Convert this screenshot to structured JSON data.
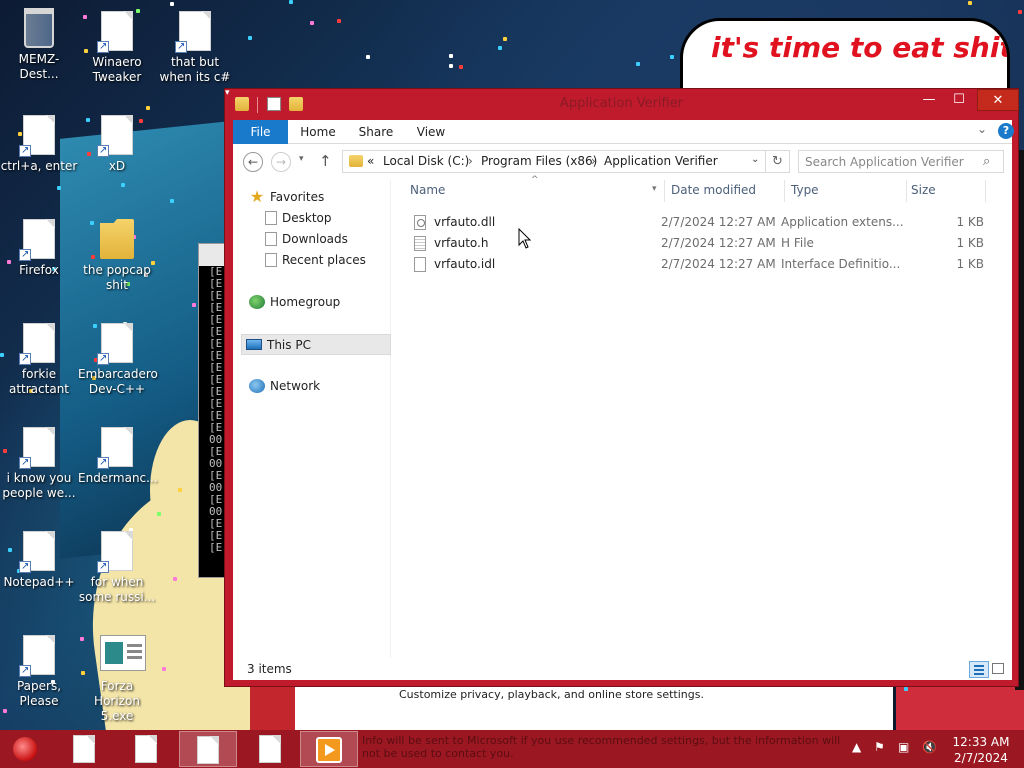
{
  "bubble_text": "it's time to eat shit",
  "desktop_icons": [
    {
      "label": "MEMZ-Dest..."
    },
    {
      "label": "Winaero Tweaker"
    },
    {
      "label": "that but when its c#"
    },
    {
      "label": "ctrl+a, enter"
    },
    {
      "label": "xD"
    },
    {
      "label": "Firefox"
    },
    {
      "label": "the popcap shit"
    },
    {
      "label": "forkie attractant"
    },
    {
      "label": "Embarcadero Dev-C++"
    },
    {
      "label": "i know you people we..."
    },
    {
      "label": "Endermanc..."
    },
    {
      "label": "Notepad++"
    },
    {
      "label": "for when some russi..."
    },
    {
      "label": "Papers, Please"
    },
    {
      "label": "Forza Horizon 5.exe"
    }
  ],
  "console": {
    "lines": [
      "[E",
      "[E",
      "[E",
      "[E",
      "[E",
      "[E",
      "[E",
      "[E",
      "[E",
      "[E",
      "[E",
      "[E",
      "[E",
      "[E",
      "00",
      "[E",
      "00",
      "[E",
      "00",
      "[E",
      "00",
      "[E",
      "[E",
      "[E"
    ]
  },
  "setup_window": {
    "text": "Customize privacy, playback, and online store settings."
  },
  "explorer": {
    "title": "Application Verifier",
    "ribbon_tabs": {
      "file": "File",
      "home": "Home",
      "share": "Share",
      "view": "View"
    },
    "breadcrumb": {
      "overflow": "«",
      "c1": "Local Disk (C:)",
      "c2": "Program Files (x86)",
      "c3": "Application Verifier",
      "sep": "›"
    },
    "search_placeholder": "Search Application Verifier",
    "nav": {
      "favorites": "Favorites",
      "desktop": "Desktop",
      "downloads": "Downloads",
      "recent": "Recent places",
      "homegroup": "Homegroup",
      "thispc": "This PC",
      "network": "Network"
    },
    "columns": {
      "name": "Name",
      "date": "Date modified",
      "type": "Type",
      "size": "Size"
    },
    "files": [
      {
        "name": "vrfauto.dll",
        "date": "2/7/2024 12:27 AM",
        "type": "Application extens...",
        "size": "1 KB"
      },
      {
        "name": "vrfauto.h",
        "date": "2/7/2024 12:27 AM",
        "type": "H File",
        "size": "1 KB"
      },
      {
        "name": "vrfauto.idl",
        "date": "2/7/2024 12:27 AM",
        "type": "Interface Definitio...",
        "size": "1 KB"
      }
    ],
    "status": "3 items"
  },
  "taskbar": {
    "notice": "Info will be sent to Microsoft if you use recommended settings, but the information will not be used to contact you.",
    "time": "12:33 AM",
    "date": "2/7/2024"
  },
  "colors": {
    "window_frame": "#c01b2c",
    "taskbar": "#9b1822",
    "file_tab": "#1979ca",
    "bubble_text": "#e0121f"
  }
}
